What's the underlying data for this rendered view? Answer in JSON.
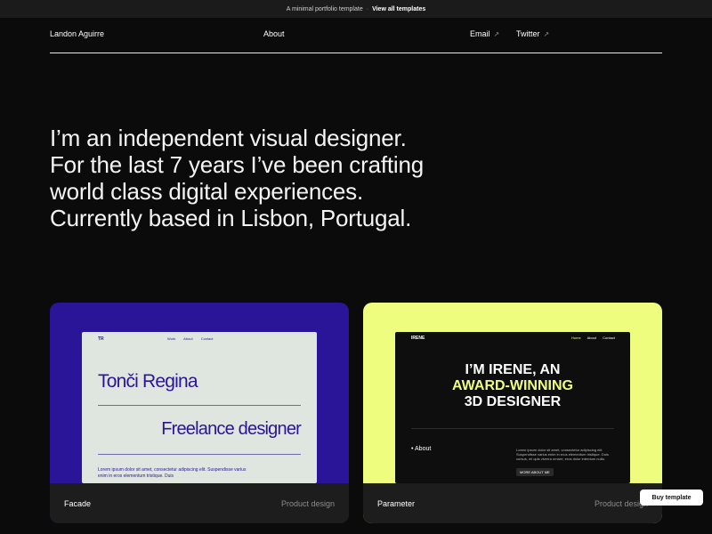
{
  "topbar": {
    "text": "A minimal portfolio template",
    "separator": "·",
    "link": "View all templates"
  },
  "nav": {
    "name": "Landon Aguirre",
    "about": "About",
    "email": "Email",
    "twitter": "Twitter",
    "external_icon": "↗"
  },
  "hero": {
    "lines": [
      "I’m an independent visual designer.",
      "For the last 7 years I’ve been crafting",
      "world class digital experiences.",
      "Currently based in Lisbon, Portugal."
    ]
  },
  "projects": [
    {
      "title": "Facade",
      "category": "Product design",
      "preview": {
        "logo": "TR",
        "nav": [
          "Work",
          "About",
          "Contact"
        ],
        "name": "Tonči Regina",
        "role": "Freelance designer",
        "body": "Lorem ipsum dolor sit amet, consectetur adipiscing elit. Suspendisse varius enim in eros elementum tristique. Duis"
      }
    },
    {
      "title": "Parameter",
      "category": "Product design",
      "preview": {
        "logo": "IRENE",
        "nav": [
          "Home",
          "About",
          "Contact"
        ],
        "headline_line1": "I’M IRENE, AN",
        "headline_line2": "AWARD-WINNING",
        "headline_line3": "3D DESIGNER",
        "section": "About",
        "text": "Lorem ipsum dolor sit amet, consectetur adipiscing elit. Suspendisse varius enim in eros elementum tristique. Duis cursus, mi quis viverra ornare, eros dolor interdum nulla.",
        "button": "MORE ABOUT ME"
      }
    }
  ],
  "buy_button": "Buy template",
  "colors": {
    "background": "#0b0b0b",
    "card_purple": "#2a1598",
    "card_lime": "#eefd7e"
  }
}
